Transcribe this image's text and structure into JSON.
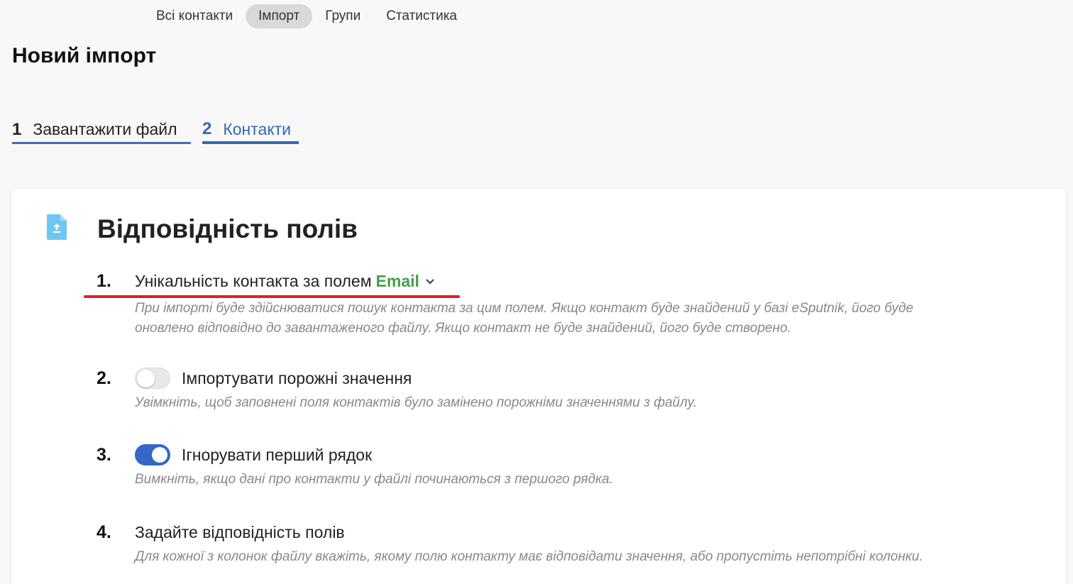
{
  "nav": {
    "tabs": [
      {
        "label": "Всі контакти"
      },
      {
        "label": "Імпорт",
        "active": true
      },
      {
        "label": "Групи"
      },
      {
        "label": "Статистика"
      }
    ]
  },
  "page": {
    "title": "Новий імпорт"
  },
  "steps": [
    {
      "num": "1",
      "label": "Завантажити файл",
      "state": "done"
    },
    {
      "num": "2",
      "label": "Контакти",
      "state": "current"
    }
  ],
  "card": {
    "title": "Відповідність полів",
    "icon": "file-upload-icon",
    "items": [
      {
        "num": "1.",
        "label": "Унікальність контакта за полем",
        "field_value": "Email",
        "desc": "При імпорті буде здійснюватися пошук контакта за цим полем. Якщо контакт буде знайдений у базі eSputnik, його буде оновлено відповідно до завантаженого файлу. Якщо контакт не буде знайдений, його буде створено."
      },
      {
        "num": "2.",
        "label": "Імпортувати порожні значення",
        "toggle": "off",
        "desc": "Увімкніть, щоб заповнені поля контактів було замінено порожніми значеннями з файлу."
      },
      {
        "num": "3.",
        "label": "Ігнорувати перший рядок",
        "toggle": "on",
        "desc": "Вимкніть, якщо дані про контакти у файлі починаються з першого рядка."
      },
      {
        "num": "4.",
        "label": "Задайте відповідність полів",
        "desc": "Для кожної з колонок файлу вкажіть, якому полю контакту має відповідати значення, або пропустіть непотрібні колонки."
      }
    ]
  },
  "colors": {
    "accent": "#3368b5",
    "email_green": "#43a047",
    "toggle_on": "#3368c9",
    "annotation_red": "#e02020"
  }
}
